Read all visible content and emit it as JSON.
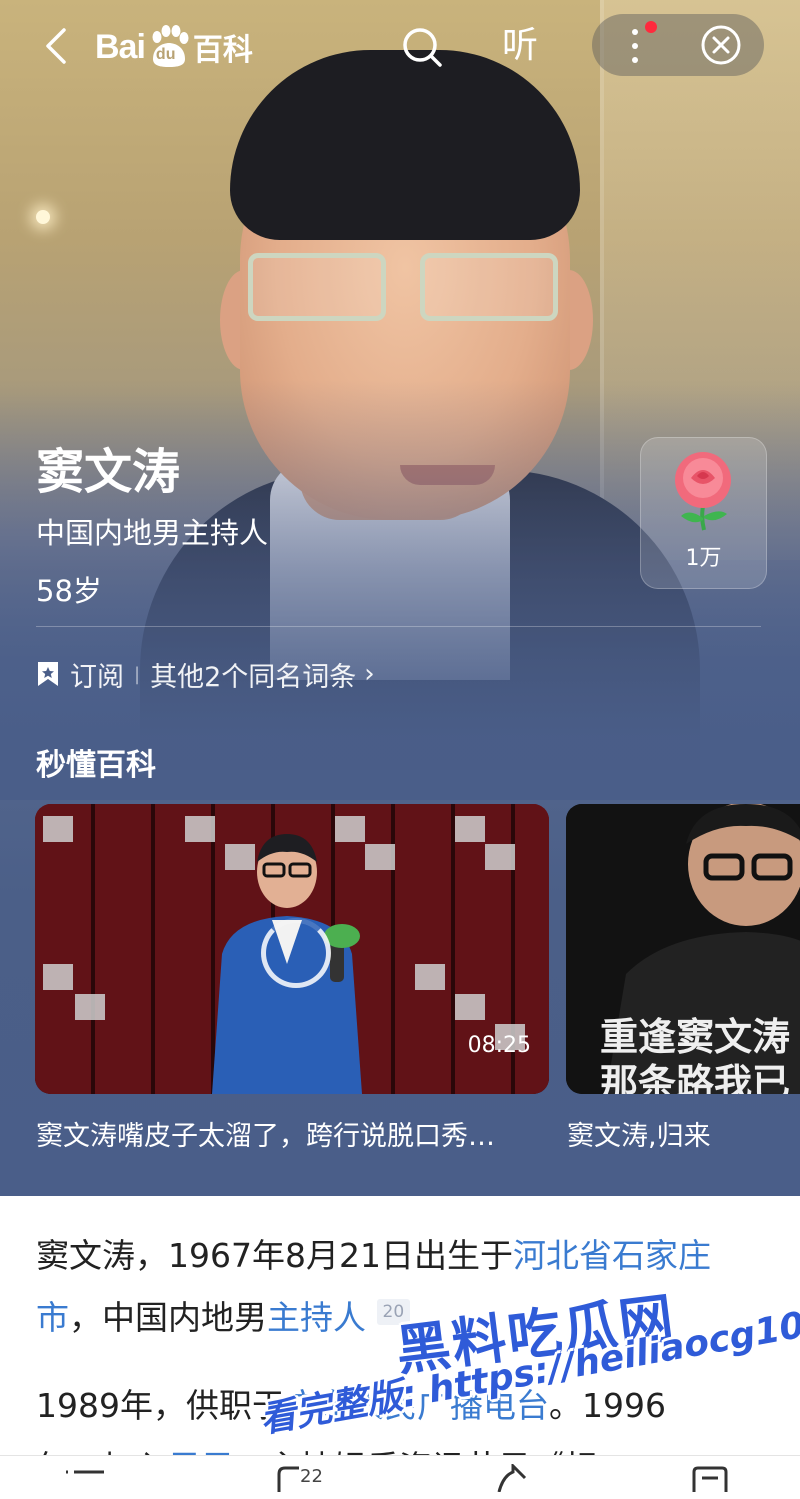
{
  "header": {
    "logo_bai": "Bai",
    "logo_du": "du",
    "logo_baike": "百科",
    "listen_label": "听"
  },
  "profile": {
    "name": "窦文涛",
    "description": "中国内地男主持人",
    "age": "58岁",
    "subscribe_label": "订阅",
    "same_name_label": "其他2个同名词条",
    "flower_count": "1万"
  },
  "section": {
    "title": "秒懂百科",
    "videos": [
      {
        "caption": "窦文涛嘴皮子太溜了，跨行说脱口秀…",
        "duration": "08:25"
      },
      {
        "caption": "窦文涛,归来",
        "overlay_line1": "重逢窦文涛",
        "overlay_line2": "那条路我已"
      }
    ]
  },
  "article": {
    "p1_a": "窦文涛，1967年8月21日出生于",
    "p1_link1": "河北省石家庄市",
    "p1_b": "，中国内地男",
    "p1_link2": "主持人",
    "p1_ref": "20",
    "p2_a": "1989年，供职于",
    "p2_link1": "广东人民广播电台",
    "p2_b": "。1996",
    "p3_a": "年，加入",
    "p3_link1": "凤凰",
    "p3_b": "，主持娱乐资讯节目《相"
  },
  "watermark": {
    "line1": "黑料吃瓜网",
    "line2": "看完整版: https://heiliaocg10.com"
  },
  "bottom_bar": {
    "comment_count": "22"
  },
  "colors": {
    "hero_bottom": "#4a5e89",
    "link": "#3a7bd0",
    "notification_dot": "#ff2a3d"
  }
}
